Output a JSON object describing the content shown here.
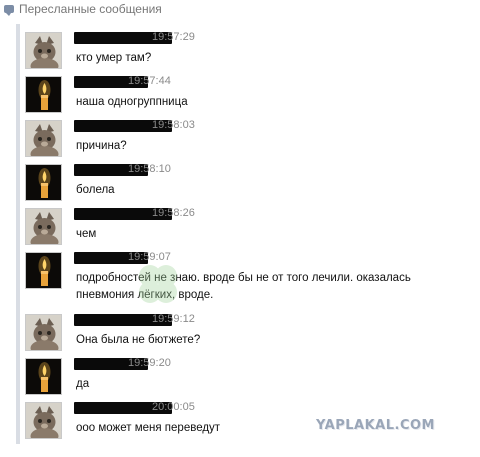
{
  "header": {
    "icon": "speech-bubble-icon",
    "title": "Пересланные сообщения"
  },
  "messages": [
    {
      "avatar": "cat",
      "time": "19:57:29",
      "text": "кто умер там?"
    },
    {
      "avatar": "candle",
      "time": "19:57:44",
      "text": "наша одногруппница"
    },
    {
      "avatar": "cat",
      "time": "19:58:03",
      "text": "причина?"
    },
    {
      "avatar": "candle",
      "time": "19:58:10",
      "text": "болела"
    },
    {
      "avatar": "cat",
      "time": "19:58:26",
      "text": "чем"
    },
    {
      "avatar": "candle",
      "time": "19:59:07",
      "text": "подробностей не знаю. вроде бы не от того лечили. оказалась\nпневмония лёгких, вроде."
    },
    {
      "avatar": "cat",
      "time": "19:59:12",
      "text": "Она была не бютжете?"
    },
    {
      "avatar": "candle",
      "time": "19:59:20",
      "text": "да"
    },
    {
      "avatar": "cat",
      "time": "20:00:05",
      "text": "ооо может меня переведут"
    }
  ],
  "watermark": "YAPLAKAL.COM",
  "colors": {
    "thread_bar": "#d9dde4",
    "name_redaction": "#0a0a0a",
    "time": "#8a8a8a",
    "watermark": "#9aa6b8"
  }
}
